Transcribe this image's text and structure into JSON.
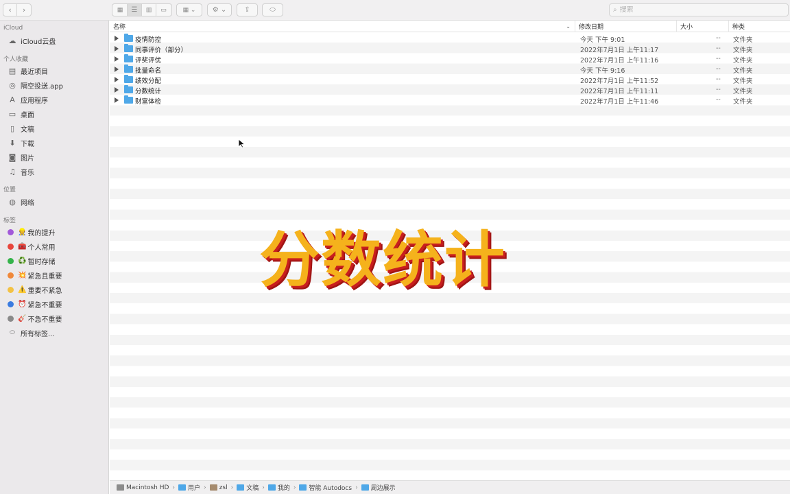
{
  "toolbar": {
    "back_icon": "chevron-left-icon",
    "forward_icon": "chevron-right-icon",
    "search_placeholder": "搜索"
  },
  "sidebar": {
    "sections": {
      "icloud": "iCloud",
      "favorites": "个人收藏",
      "locations": "位置",
      "tags": "标签"
    },
    "icloud_items": [
      {
        "label": "iCloud云盘",
        "icon": "cloud-icon"
      }
    ],
    "favorites_items": [
      {
        "label": "最近项目",
        "icon": "clock-icon"
      },
      {
        "label": "隔空投送.app",
        "icon": "airdrop-icon"
      },
      {
        "label": "应用程序",
        "icon": "apps-icon"
      },
      {
        "label": "桌面",
        "icon": "desktop-icon"
      },
      {
        "label": "文稿",
        "icon": "document-icon"
      },
      {
        "label": "下载",
        "icon": "download-icon"
      },
      {
        "label": "图片",
        "icon": "camera-icon"
      },
      {
        "label": "音乐",
        "icon": "music-icon"
      }
    ],
    "locations_items": [
      {
        "label": "网络",
        "icon": "globe-icon"
      }
    ],
    "tags_items": [
      {
        "label": "我的提升",
        "color": "#a259d9",
        "emoji": "👷"
      },
      {
        "label": "个人常用",
        "color": "#e8453c",
        "emoji": "🧰"
      },
      {
        "label": "暂时存储",
        "color": "#34b34a",
        "emoji": "♻️"
      },
      {
        "label": "紧急且重要",
        "color": "#f0883a",
        "emoji": "💥"
      },
      {
        "label": "重要不紧急",
        "color": "#f3c244",
        "emoji": "⚠️"
      },
      {
        "label": "紧急不重要",
        "color": "#3a7be0",
        "emoji": "⏰"
      },
      {
        "label": "不急不重要",
        "color": "#8a8a8a",
        "emoji": "🎸"
      },
      {
        "label": "所有标签...",
        "color": "",
        "emoji": ""
      }
    ]
  },
  "columns": {
    "name": "名称",
    "date": "修改日期",
    "size": "大小",
    "kind": "种类"
  },
  "files": [
    {
      "name": "疫情防控",
      "date": "今天 下午 9:01",
      "size": "--",
      "kind": "文件夹"
    },
    {
      "name": "同事评价（部分）",
      "date": "2022年7月1日 上午11:17",
      "size": "--",
      "kind": "文件夹"
    },
    {
      "name": "评奖评优",
      "date": "2022年7月1日 上午11:16",
      "size": "--",
      "kind": "文件夹"
    },
    {
      "name": "批量命名",
      "date": "今天 下午 9:16",
      "size": "--",
      "kind": "文件夹"
    },
    {
      "name": "绩效分配",
      "date": "2022年7月1日 上午11:52",
      "size": "--",
      "kind": "文件夹"
    },
    {
      "name": "分数统计",
      "date": "2022年7月1日 上午11:11",
      "size": "--",
      "kind": "文件夹"
    },
    {
      "name": "财富体检",
      "date": "2022年7月1日 上午11:46",
      "size": "--",
      "kind": "文件夹"
    }
  ],
  "overlay_title": "分数统计",
  "pathbar": [
    "Macintosh HD",
    "用户",
    "zsl",
    "文稿",
    "我的",
    "智能 Autodocs",
    "周边展示"
  ],
  "colors": {
    "overlay_fill": "#f5b21c",
    "overlay_shadow": "#c81e1e",
    "folder": "#4fa8e8"
  }
}
